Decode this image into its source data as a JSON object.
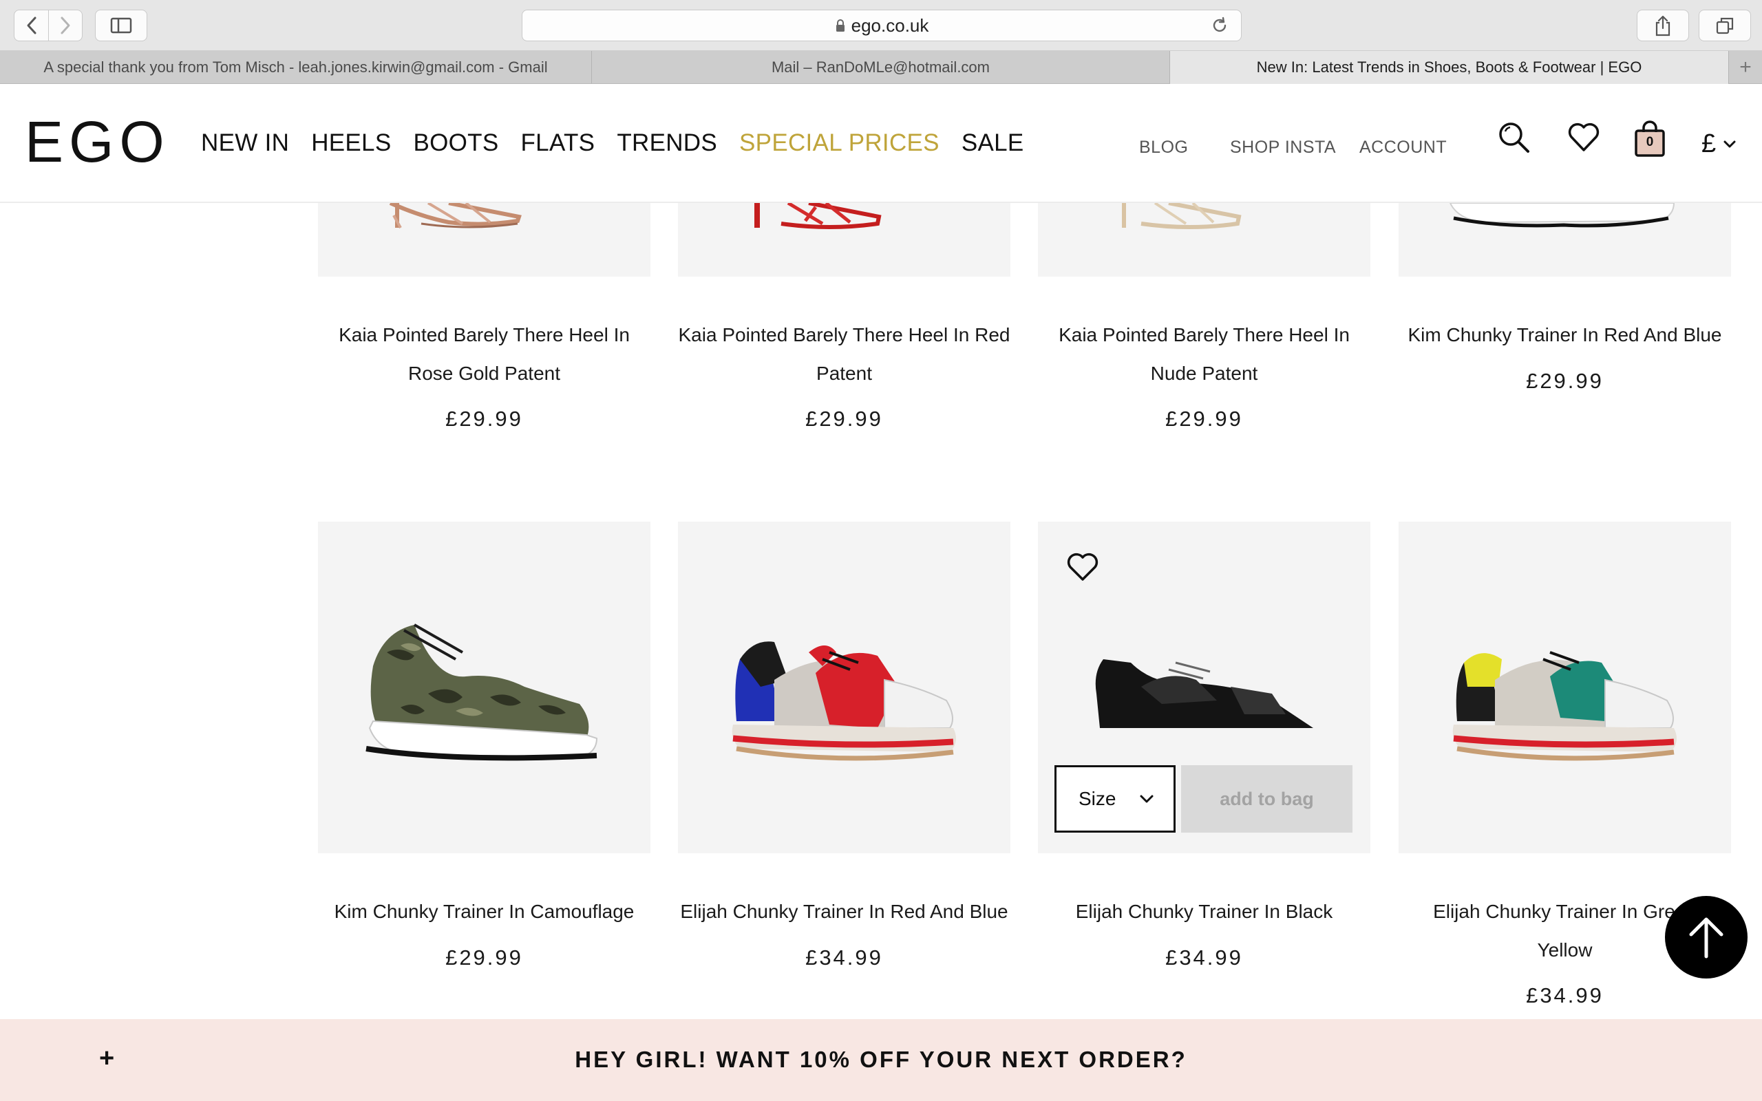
{
  "browser": {
    "url": "ego.co.uk",
    "tabs": [
      {
        "label": "A special thank you from Tom Misch - leah.jones.kirwin@gmail.com - Gmail"
      },
      {
        "label": "Mail – RanDoMLe@hotmail.com"
      },
      {
        "label": "New In: Latest Trends in Shoes, Boots & Footwear | EGO"
      }
    ],
    "new_tab_label": "+"
  },
  "site": {
    "logo": "EGO",
    "nav": [
      "NEW IN",
      "HEELS",
      "BOOTS",
      "FLATS",
      "TRENDS",
      "SPECIAL PRICES",
      "SALE"
    ],
    "secondary_nav": {
      "blog": "BLOG",
      "insta": "SHOP INSTA",
      "account": "ACCOUNT"
    },
    "bag_count": "0",
    "currency": "£",
    "accent_color": "#bfa43a"
  },
  "products_top": [
    {
      "name": "Kaia Pointed Barely There Heel In Rose Gold Patent",
      "price": "£29.99"
    },
    {
      "name": "Kaia Pointed Barely There Heel In Red Patent",
      "price": "£29.99"
    },
    {
      "name": "Kaia Pointed Barely There Heel In Nude Patent",
      "price": "£29.99"
    },
    {
      "name": "Kim Chunky Trainer In Red And Blue",
      "price": "£29.99"
    }
  ],
  "products_bottom": [
    {
      "name": "Kim Chunky Trainer In Camouflage",
      "price": "£29.99"
    },
    {
      "name": "Elijah Chunky Trainer In Red And Blue",
      "price": "£34.99"
    },
    {
      "name": "Elijah Chunky Trainer In Black",
      "price": "£34.99"
    },
    {
      "name": "Elijah Chunky Trainer In Green Yellow",
      "price": "£34.99"
    }
  ],
  "quick_add": {
    "size_label": "Size",
    "add_label": "add to bag"
  },
  "promo": {
    "plus": "+",
    "text": "HEY GIRL! WANT 10% OFF YOUR NEXT ORDER?"
  }
}
